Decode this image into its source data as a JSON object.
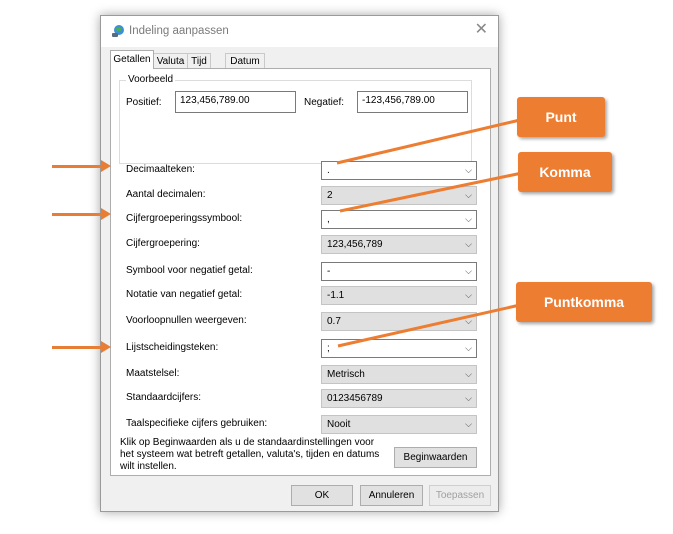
{
  "dialog": {
    "title": "Indeling aanpassen",
    "tabs": [
      {
        "label": "Getallen",
        "active": true
      },
      {
        "label": "Valuta",
        "active": false
      },
      {
        "label": "Tijd",
        "active": false
      },
      {
        "label": "Datum",
        "active": false
      }
    ],
    "example": {
      "legend": "Voorbeeld",
      "positive_label": "Positief:",
      "positive_value": "123,456,789.00",
      "negative_label": "Negatief:",
      "negative_value": "-123,456,789.00"
    },
    "rows": [
      {
        "label": "Decimaalteken:",
        "value": ".",
        "editable": true
      },
      {
        "label": "Aantal decimalen:",
        "value": "2",
        "editable": false
      },
      {
        "label": "Cijfergroeperingssymbool:",
        "value": ",",
        "editable": true
      },
      {
        "label": "Cijfergroepering:",
        "value": "123,456,789",
        "editable": false
      },
      {
        "label": "Symbool voor negatief getal:",
        "value": "-",
        "editable": true
      },
      {
        "label": "Notatie van negatief getal:",
        "value": "-1.1",
        "editable": false
      },
      {
        "label": "Voorloopnullen weergeven:",
        "value": "0.7",
        "editable": false
      },
      {
        "label": "Lijstscheidingsteken:",
        "value": ";",
        "editable": true
      },
      {
        "label": "Maatstelsel:",
        "value": "Metrisch",
        "editable": false
      },
      {
        "label": "Standaardcijfers:",
        "value": "0123456789",
        "editable": false
      },
      {
        "label": "Taalspecifieke cijfers gebruiken:",
        "value": "Nooit",
        "editable": false
      }
    ],
    "footnote": "Klik op Beginwaarden als u de standaardinstellingen voor het systeem wat betreft getallen, valuta's, tijden en datums wilt instellen.",
    "reset_button": "Beginwaarden",
    "ok_button": "OK",
    "cancel_button": "Annuleren",
    "apply_button": "Toepassen"
  },
  "annotations": {
    "callouts": [
      "Punt",
      "Komma",
      "Puntkomma"
    ],
    "color": "#ed7d31"
  }
}
